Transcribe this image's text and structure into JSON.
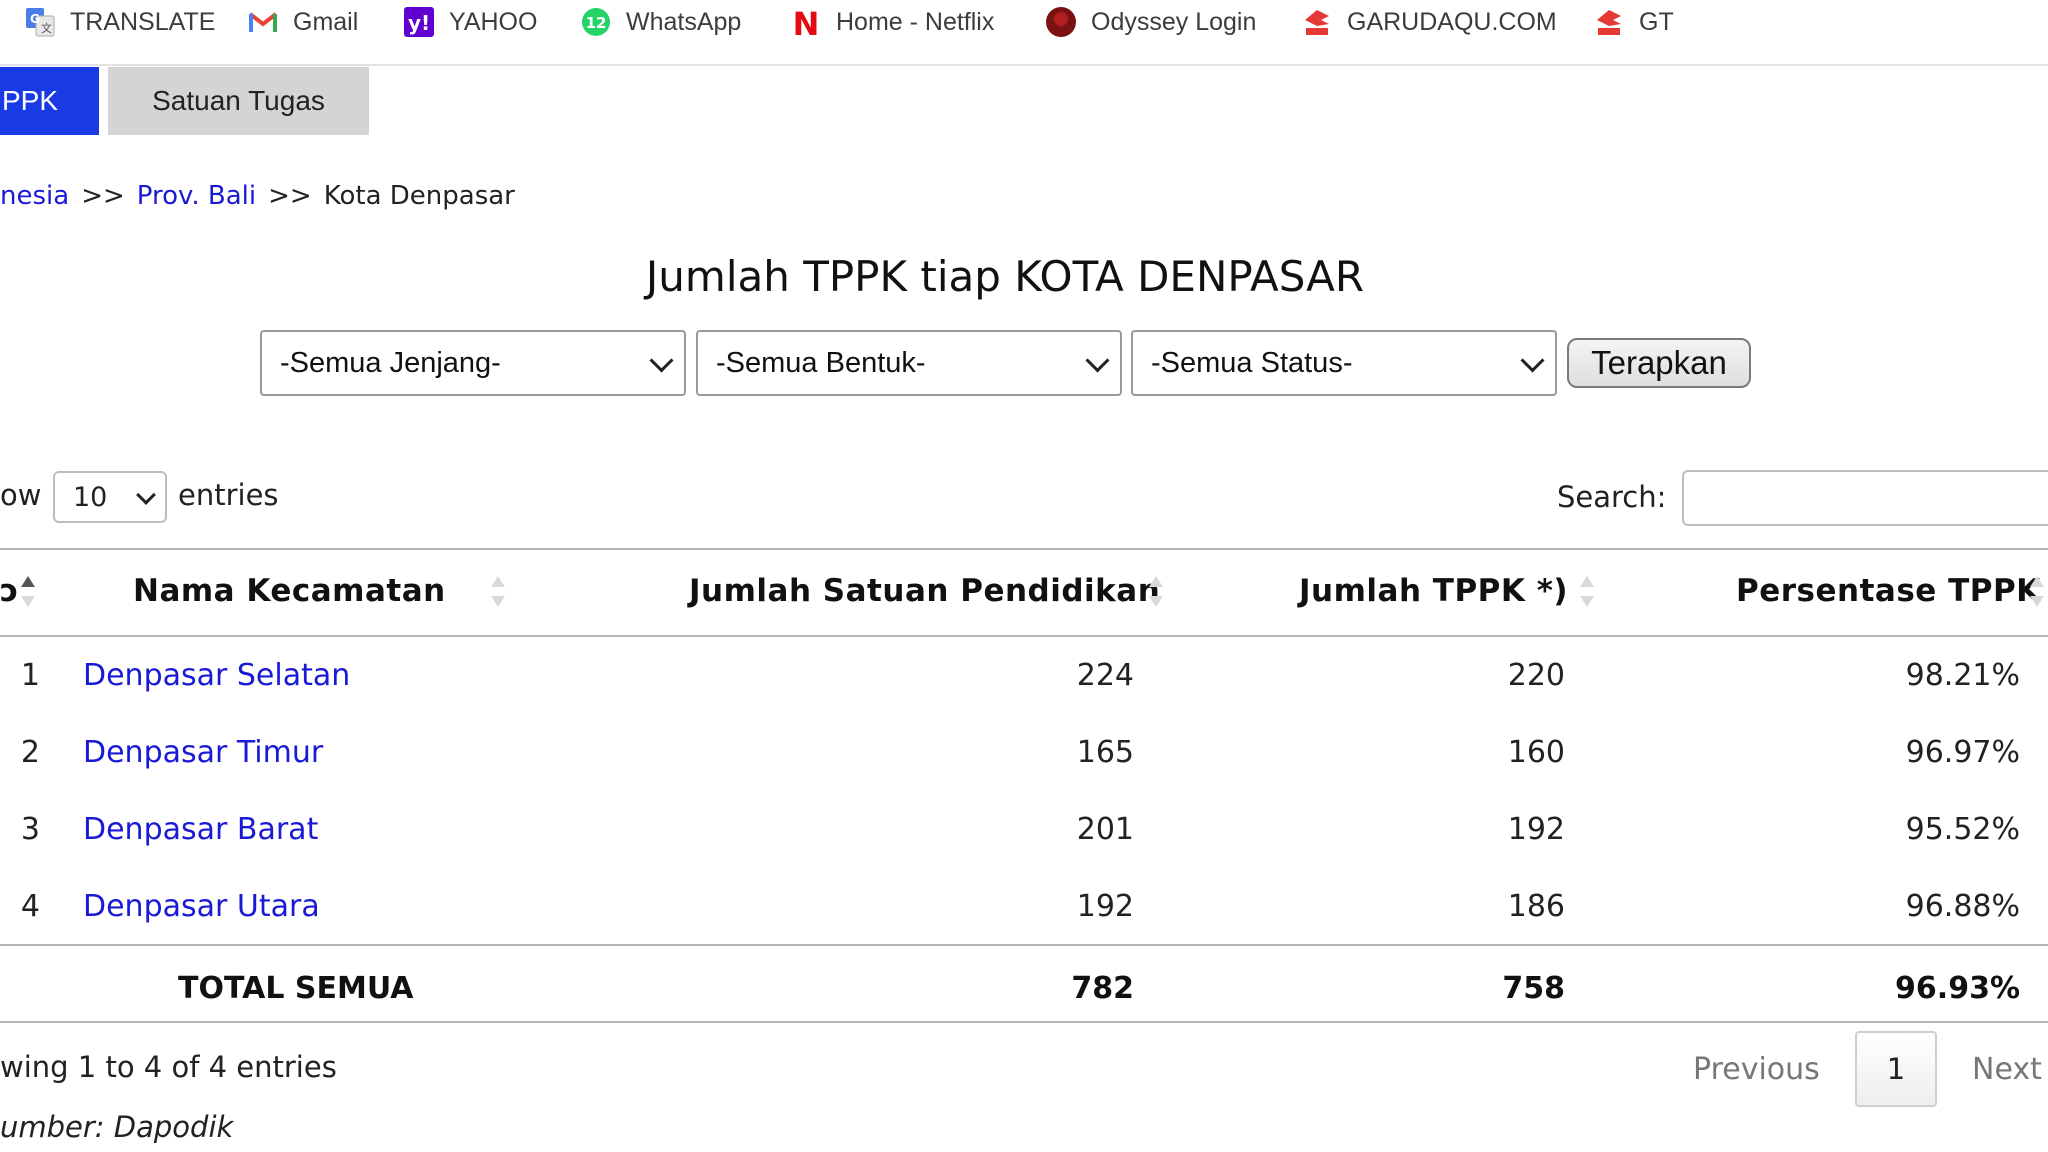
{
  "bookmarks": [
    {
      "label": "TRANSLATE",
      "icon": "google-translate-icon"
    },
    {
      "label": "Gmail",
      "icon": "gmail-icon"
    },
    {
      "label": "YAHOO",
      "icon": "yahoo-icon"
    },
    {
      "label": "WhatsApp",
      "icon": "whatsapp-icon",
      "badge": "12"
    },
    {
      "label": "Home - Netflix",
      "icon": "netflix-icon",
      "glyph": "N"
    },
    {
      "label": "Odyssey Login",
      "icon": "odyssey-icon"
    },
    {
      "label": "GARUDAQU.COM",
      "icon": "garuda-icon"
    },
    {
      "label": "GT",
      "icon": "garuda-icon"
    }
  ],
  "tabs": [
    {
      "label": "PPK",
      "active": true
    },
    {
      "label": "Satuan Tugas",
      "active": false
    }
  ],
  "breadcrumb": {
    "items": [
      "nesia",
      "Prov. Bali"
    ],
    "separator": ">>",
    "current": "Kota Denpasar"
  },
  "title": "Jumlah TPPK tiap KOTA DENPASAR",
  "filters": {
    "jenjang": "-Semua Jenjang-",
    "bentuk": "-Semua Bentuk-",
    "status": "-Semua Status-",
    "apply_label": "Terapkan"
  },
  "entries": {
    "show_label": "ow",
    "value": "10",
    "suffix": "entries"
  },
  "search": {
    "label": "Search:",
    "value": ""
  },
  "table": {
    "headers": [
      "Nama Kecamatan",
      "Jumlah Satuan Pendidikan",
      "Jumlah TPPK *)",
      "Persentase TPPK"
    ],
    "rows": [
      {
        "no": "1",
        "nama": "Denpasar Selatan",
        "satuan": "224",
        "tppk": "220",
        "persen": "98.21%"
      },
      {
        "no": "2",
        "nama": "Denpasar Timur",
        "satuan": "165",
        "tppk": "160",
        "persen": "96.97%"
      },
      {
        "no": "3",
        "nama": "Denpasar Barat",
        "satuan": "201",
        "tppk": "192",
        "persen": "95.52%"
      },
      {
        "no": "4",
        "nama": "Denpasar Utara",
        "satuan": "192",
        "tppk": "186",
        "persen": "96.88%"
      }
    ],
    "total": {
      "label": "TOTAL SEMUA",
      "satuan": "782",
      "tppk": "758",
      "persen": "96.93%"
    }
  },
  "info": "wing 1 to 4 of 4 entries",
  "source": "umber: Dapodik",
  "pagination": {
    "previous": "Previous",
    "page": "1",
    "next": "Next"
  },
  "colors": {
    "active_tab": "#1a3be3",
    "link": "#1a1ad6",
    "inactive_tab": "#d4d4d4"
  }
}
